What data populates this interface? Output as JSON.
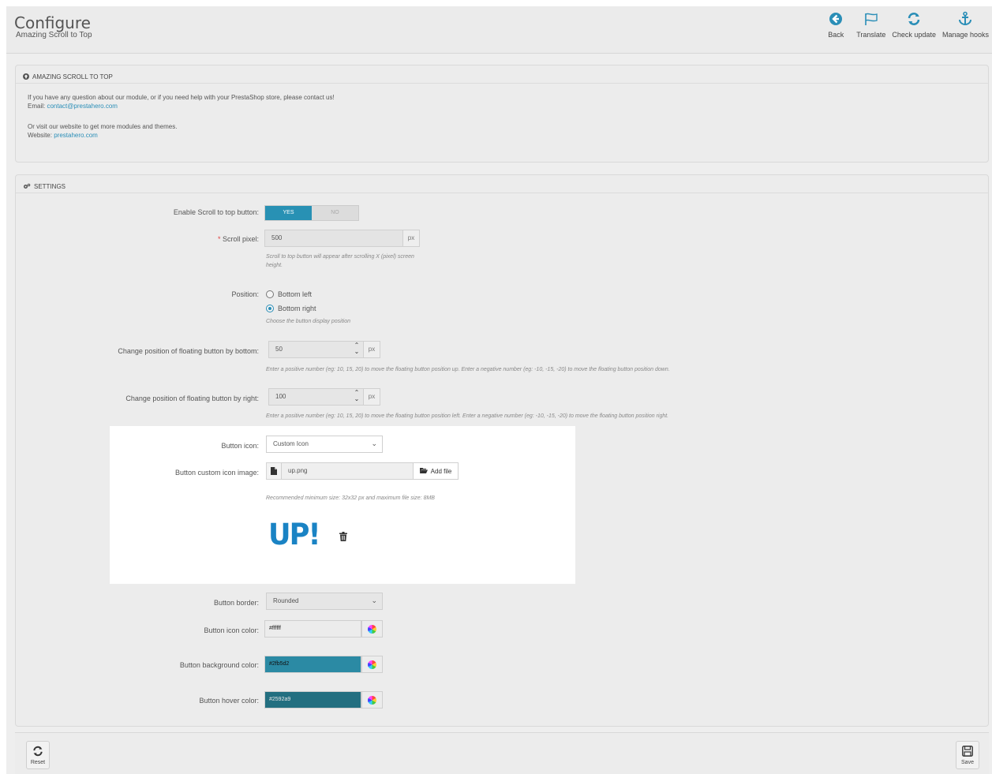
{
  "header": {
    "title": "Configure",
    "subtitle": "Amazing Scroll to Top",
    "toolbar": [
      {
        "label": "Back",
        "icon": "back-arrow-icon"
      },
      {
        "label": "Translate",
        "icon": "flag-icon"
      },
      {
        "label": "Check update",
        "icon": "refresh-icon"
      },
      {
        "label": "Manage hooks",
        "icon": "anchor-icon"
      }
    ]
  },
  "info_panel": {
    "heading": "AMAZING SCROLL TO TOP",
    "line1": "If you have any question about our module, or if you need help with your PrestaShop store, please contact us!",
    "email_label": "Email:",
    "email": "contact@prestahero.com",
    "line2": "Or visit our website to get more modules and themes.",
    "website_label": "Website:",
    "website": "prestahero.com"
  },
  "settings": {
    "heading": "SETTINGS",
    "enable_label": "Enable Scroll to top button:",
    "yes": "YES",
    "no": "NO",
    "scroll_pixel_req": "*",
    "scroll_pixel_label": "Scroll pixel:",
    "scroll_pixel_value": "500",
    "scroll_pixel_unit": "px",
    "scroll_pixel_help": "Scroll to top button will appear after scrolling X (pixel) screen height.",
    "position_label": "Position:",
    "position_left": "Bottom left",
    "position_right": "Bottom right",
    "position_help": "Choose the button display position",
    "bottom_label": "Change position of floating button by bottom:",
    "bottom_value": "50",
    "bottom_unit": "px",
    "bottom_help": "Enter a positive number (eg: 10, 15, 20) to move the floating button position up. Enter a negative number (eg: -10, -15, -20) to move the floating button position down.",
    "right_label": "Change position of floating button by right:",
    "right_value": "100",
    "right_unit": "px",
    "right_help": "Enter a positive number (eg: 10, 15, 20) to move the floating button position left. Enter a negative number (eg: -10, -15, -20) to move the floating button position right.",
    "icon_label": "Button icon:",
    "icon_value": "Custom Icon",
    "custom_icon_label": "Button custom icon image:",
    "custom_icon_file": "up.png",
    "add_file": "Add file",
    "custom_icon_help": "Recommended minimum size: 32x32 px and maximum file size: 8MB",
    "preview_text": "UP!",
    "border_label": "Button border:",
    "border_value": "Rounded",
    "icon_color_label": "Button icon color:",
    "icon_color_value": "#ffffff",
    "bg_color_label": "Button background color:",
    "bg_color_value": "#2fb5d2",
    "hover_color_label": "Button hover color:",
    "hover_color_value": "#2592a9"
  },
  "footer": {
    "reset": "Reset",
    "save": "Save"
  },
  "colors": {
    "accent": "#2a8eb7",
    "bg_color": "#2fb5d2",
    "hover_color": "#2592a9"
  }
}
